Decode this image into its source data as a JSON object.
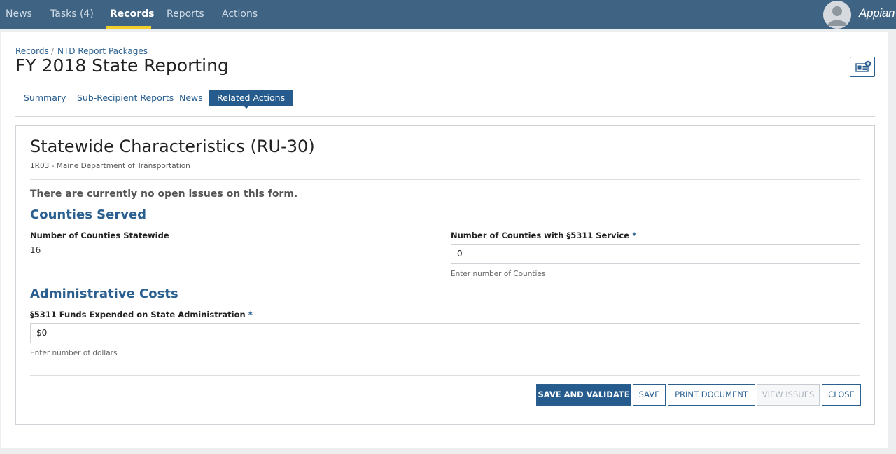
{
  "nav": {
    "items": [
      {
        "label": "News"
      },
      {
        "label": "Tasks (4)"
      },
      {
        "label": "Records"
      },
      {
        "label": "Reports"
      },
      {
        "label": "Actions"
      }
    ],
    "active": "Records",
    "brand": "Appian"
  },
  "breadcrumb": [
    "Records",
    "NTD Report Packages"
  ],
  "page_title": "FY 2018 State Reporting",
  "tabs": [
    "Summary",
    "Sub-Recipient Reports",
    "News",
    "Related Actions"
  ],
  "active_tab": "Related Actions",
  "form": {
    "title": "Statewide Characteristics (RU-30)",
    "subtitle": "1R03 - Maine Department of Transportation",
    "notice": "There are currently no open issues on this form.",
    "counties_section": "Counties Served",
    "counties_statewide_label": "Number of Counties Statewide",
    "counties_statewide_value": "16",
    "counties_5311_label": "Number of Counties with §5311 Service",
    "counties_5311_value": "0",
    "counties_5311_hint": "Enter number of Counties",
    "admin_section": "Administrative Costs",
    "funds_label": "§5311 Funds Expended on State Administration",
    "funds_value": "$0",
    "funds_hint": "Enter number of dollars",
    "required_marker": "*"
  },
  "buttons": {
    "save_validate": "SAVE AND VALIDATE",
    "save": "SAVE",
    "print": "PRINT DOCUMENT",
    "view_issues": "VIEW ISSUES",
    "close": "CLOSE"
  },
  "colors": {
    "topbar": "#3e6383",
    "accent": "#2a5f8f",
    "active_tab": "#255c8d",
    "nav_underline": "#f2cf2a"
  }
}
